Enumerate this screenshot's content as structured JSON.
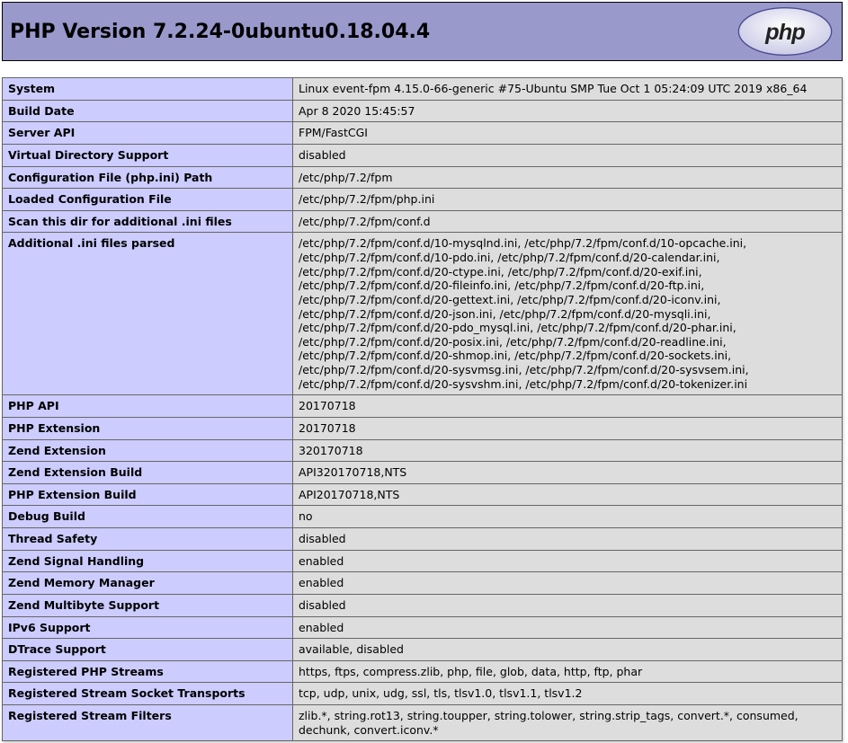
{
  "header": {
    "title": "PHP Version 7.2.24-0ubuntu0.18.04.4"
  },
  "rows": [
    {
      "label": "System",
      "value": "Linux event-fpm 4.15.0-66-generic #75-Ubuntu SMP Tue Oct 1 05:24:09 UTC 2019 x86_64"
    },
    {
      "label": "Build Date",
      "value": "Apr 8 2020 15:45:57"
    },
    {
      "label": "Server API",
      "value": "FPM/FastCGI"
    },
    {
      "label": "Virtual Directory Support",
      "value": "disabled"
    },
    {
      "label": "Configuration File (php.ini) Path",
      "value": "/etc/php/7.2/fpm"
    },
    {
      "label": "Loaded Configuration File",
      "value": "/etc/php/7.2/fpm/php.ini"
    },
    {
      "label": "Scan this dir for additional .ini files",
      "value": "/etc/php/7.2/fpm/conf.d"
    },
    {
      "label": "Additional .ini files parsed",
      "value": "/etc/php/7.2/fpm/conf.d/10-mysqlnd.ini, /etc/php/7.2/fpm/conf.d/10-opcache.ini, /etc/php/7.2/fpm/conf.d/10-pdo.ini, /etc/php/7.2/fpm/conf.d/20-calendar.ini, /etc/php/7.2/fpm/conf.d/20-ctype.ini, /etc/php/7.2/fpm/conf.d/20-exif.ini, /etc/php/7.2/fpm/conf.d/20-fileinfo.ini, /etc/php/7.2/fpm/conf.d/20-ftp.ini, /etc/php/7.2/fpm/conf.d/20-gettext.ini, /etc/php/7.2/fpm/conf.d/20-iconv.ini, /etc/php/7.2/fpm/conf.d/20-json.ini, /etc/php/7.2/fpm/conf.d/20-mysqli.ini, /etc/php/7.2/fpm/conf.d/20-pdo_mysql.ini, /etc/php/7.2/fpm/conf.d/20-phar.ini, /etc/php/7.2/fpm/conf.d/20-posix.ini, /etc/php/7.2/fpm/conf.d/20-readline.ini, /etc/php/7.2/fpm/conf.d/20-shmop.ini, /etc/php/7.2/fpm/conf.d/20-sockets.ini, /etc/php/7.2/fpm/conf.d/20-sysvmsg.ini, /etc/php/7.2/fpm/conf.d/20-sysvsem.ini, /etc/php/7.2/fpm/conf.d/20-sysvshm.ini, /etc/php/7.2/fpm/conf.d/20-tokenizer.ini"
    },
    {
      "label": "PHP API",
      "value": "20170718"
    },
    {
      "label": "PHP Extension",
      "value": "20170718"
    },
    {
      "label": "Zend Extension",
      "value": "320170718"
    },
    {
      "label": "Zend Extension Build",
      "value": "API320170718,NTS"
    },
    {
      "label": "PHP Extension Build",
      "value": "API20170718,NTS"
    },
    {
      "label": "Debug Build",
      "value": "no"
    },
    {
      "label": "Thread Safety",
      "value": "disabled"
    },
    {
      "label": "Zend Signal Handling",
      "value": "enabled"
    },
    {
      "label": "Zend Memory Manager",
      "value": "enabled"
    },
    {
      "label": "Zend Multibyte Support",
      "value": "disabled"
    },
    {
      "label": "IPv6 Support",
      "value": "enabled"
    },
    {
      "label": "DTrace Support",
      "value": "available, disabled"
    },
    {
      "label": "Registered PHP Streams",
      "value": "https, ftps, compress.zlib, php, file, glob, data, http, ftp, phar"
    },
    {
      "label": "Registered Stream Socket Transports",
      "value": "tcp, udp, unix, udg, ssl, tls, tlsv1.0, tlsv1.1, tlsv1.2"
    },
    {
      "label": "Registered Stream Filters",
      "value": "zlib.*, string.rot13, string.toupper, string.tolower, string.strip_tags, convert.*, consumed, dechunk, convert.iconv.*"
    }
  ]
}
